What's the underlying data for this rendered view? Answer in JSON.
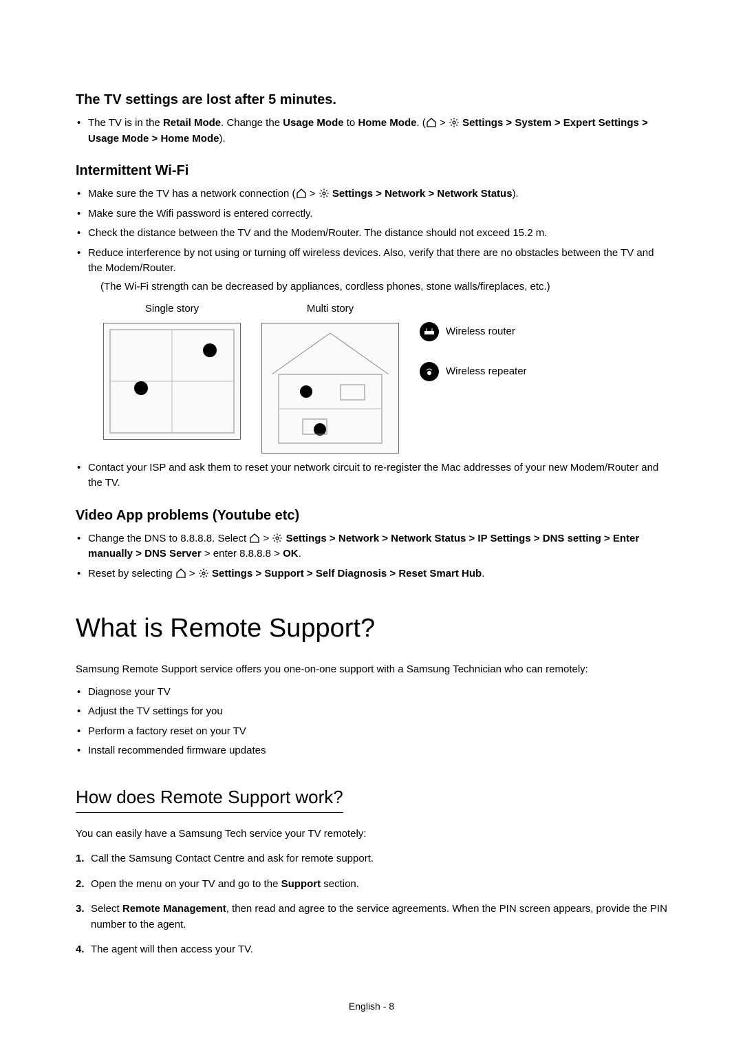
{
  "section1": {
    "heading": "The TV settings are lost after 5 minutes.",
    "bullet1_pre": "The TV is in the ",
    "bullet1_bold1": "Retail Mode",
    "bullet1_mid1": ". Change the ",
    "bullet1_bold2": "Usage Mode",
    "bullet1_mid2": " to ",
    "bullet1_bold3": "Home Mode",
    "bullet1_mid3": ". (",
    "bullet1_path": " Settings > System > Expert Settings > Usage Mode > Home Mode",
    "bullet1_end": ")."
  },
  "section2": {
    "heading": "Intermittent Wi-Fi",
    "b1_pre": "Make sure the TV has a network connection (",
    "b1_path": " Settings > Network > Network Status",
    "b1_end": ").",
    "b2": "Make sure the Wifi password is entered correctly.",
    "b3": "Check the distance between the TV and the Modem/Router. The distance should not exceed 15.2 m.",
    "b4": "Reduce interference by not using or turning off wireless devices. Also, verify that there are no obstacles between the TV and the Modem/Router.",
    "b4_note": "(The Wi-Fi strength can be decreased by appliances, cordless phones, stone walls/fireplaces, etc.)",
    "diagram_single": "Single story",
    "diagram_multi": "Multi story",
    "legend_router": "Wireless router",
    "legend_repeater": "Wireless repeater",
    "b5": "Contact your ISP and ask them to reset your network circuit to re-register the Mac addresses of your new Modem/Router and the TV."
  },
  "section3": {
    "heading": "Video App problems (Youtube etc)",
    "b1_pre": "Change the DNS to 8.8.8.8. Select ",
    "b1_path": " Settings > Network > Network Status > IP Settings > DNS setting > Enter manually > DNS Server",
    "b1_mid": " > enter 8.8.8.8 > ",
    "b1_ok": "OK",
    "b1_end": ".",
    "b2_pre": "Reset by selecting ",
    "b2_path": " Settings > Support > Self Diagnosis > Reset Smart Hub",
    "b2_end": "."
  },
  "section4": {
    "title": "What is Remote Support?",
    "intro": "Samsung Remote Support service offers you one-on-one support with a Samsung Technician who can remotely:",
    "b1": "Diagnose your TV",
    "b2": "Adjust the TV settings for you",
    "b3": "Perform a factory reset on your TV",
    "b4": "Install recommended firmware updates"
  },
  "section5": {
    "heading": "How does Remote Support work?",
    "intro": "You can easily have a Samsung Tech service your TV remotely:",
    "s1": "Call the Samsung Contact Centre and ask for remote support.",
    "s2_pre": "Open the menu on your TV and go to the ",
    "s2_bold": "Support",
    "s2_end": " section.",
    "s3_pre": "Select ",
    "s3_bold": "Remote Management",
    "s3_end": ", then read and agree to the service agreements. When the PIN screen appears, provide the PIN number to the agent.",
    "s4": "The agent will then access your TV."
  },
  "footer": "English - 8"
}
